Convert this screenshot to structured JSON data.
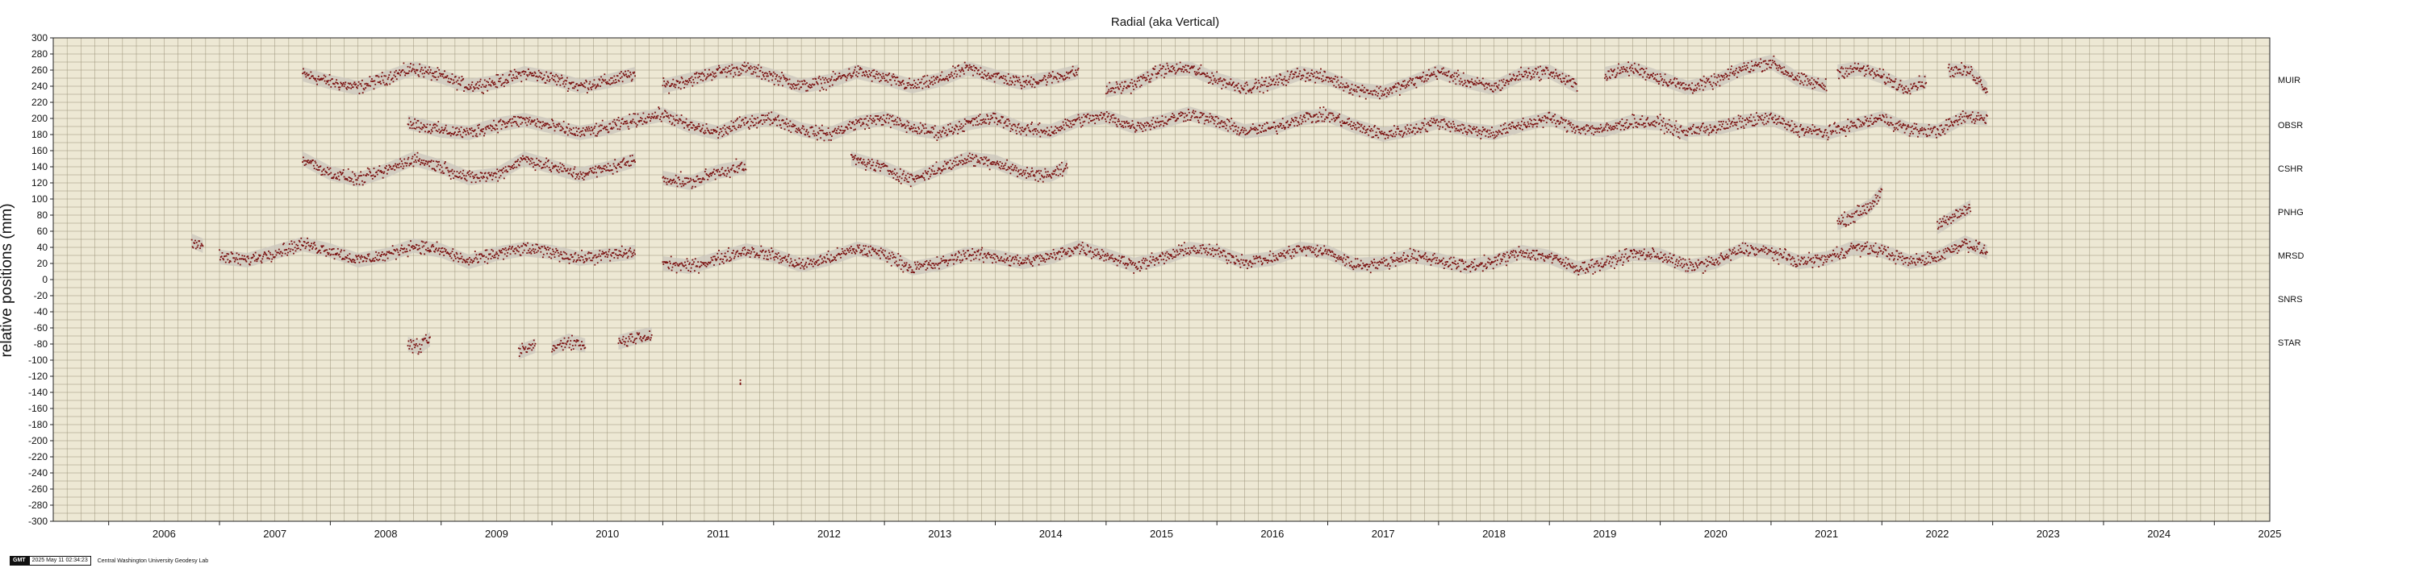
{
  "chart_data": {
    "type": "scatter",
    "title": "Radial (aka Vertical)",
    "ylabel": "relative positions (mm)",
    "xlabel": "",
    "xlim": [
      2005.5,
      2025.5
    ],
    "ylim": [
      -300,
      300
    ],
    "grid": true,
    "x_ticks": [
      "2006",
      "2007",
      "2008",
      "2009",
      "2010",
      "2011",
      "2012",
      "2013",
      "2014",
      "2015",
      "2016",
      "2017",
      "2018",
      "2019",
      "2020",
      "2021",
      "2022",
      "2023",
      "2024",
      "2025"
    ],
    "y_ticks": [
      300,
      280,
      260,
      240,
      220,
      200,
      180,
      160,
      140,
      120,
      100,
      80,
      60,
      40,
      20,
      0,
      -20,
      -40,
      -60,
      -80,
      -100,
      -120,
      -140,
      -160,
      -180,
      -200,
      -220,
      -240,
      -260,
      -280,
      -300
    ],
    "series": [
      {
        "name": "MUIR",
        "label_y": 248,
        "color": "#7a1010",
        "segments": [
          {
            "x": [
              2007.75,
              2008.0,
              2008.25,
              2008.5,
              2008.75,
              2009.0,
              2009.25,
              2009.5,
              2009.75,
              2010.0,
              2010.25,
              2010.5,
              2010.75
            ],
            "y": [
              255,
              245,
              238,
              250,
              262,
              252,
              240,
              245,
              256,
              250,
              240,
              246,
              255
            ]
          },
          {
            "x": [
              2011.0,
              2011.25,
              2011.5,
              2011.75,
              2012.0,
              2012.25,
              2012.5,
              2012.75,
              2013.0,
              2013.25,
              2013.5,
              2013.75,
              2014.0,
              2014.25,
              2014.5,
              2014.75
            ],
            "y": [
              240,
              248,
              258,
              262,
              252,
              240,
              246,
              258,
              250,
              240,
              248,
              262,
              252,
              244,
              250,
              258
            ]
          },
          {
            "x": [
              2015.0,
              2015.25,
              2015.5,
              2015.75,
              2016.0,
              2016.25,
              2016.5,
              2016.75,
              2017.0,
              2017.25,
              2017.5,
              2017.75,
              2018.0,
              2018.25,
              2018.5,
              2018.75,
              2019.0,
              2019.25
            ],
            "y": [
              235,
              242,
              260,
              262,
              248,
              238,
              244,
              256,
              250,
              236,
              232,
              244,
              258,
              246,
              238,
              255,
              258,
              240
            ]
          },
          {
            "x": [
              2019.5,
              2019.75,
              2020.0,
              2020.25,
              2020.5,
              2020.75,
              2021.0,
              2021.25,
              2021.5
            ],
            "y": [
              255,
              262,
              250,
              238,
              246,
              262,
              270,
              248,
              240
            ]
          },
          {
            "x": [
              2021.6,
              2021.8,
              2022.0,
              2022.2,
              2022.4
            ],
            "y": [
              258,
              262,
              252,
              238,
              246
            ]
          },
          {
            "x": [
              2022.6,
              2022.8,
              2022.95
            ],
            "y": [
              260,
              258,
              236
            ]
          }
        ]
      },
      {
        "name": "OBSR",
        "label_y": 192,
        "color": "#7a1010",
        "segments": [
          {
            "x": [
              2008.7,
              2009.0,
              2009.25,
              2009.5,
              2009.75,
              2010.0,
              2010.25,
              2010.5,
              2010.75,
              2011.0,
              2011.25,
              2011.5,
              2011.75,
              2012.0,
              2012.25,
              2012.5,
              2012.75,
              2013.0,
              2013.25,
              2013.5,
              2013.75,
              2014.0,
              2014.25,
              2014.5,
              2014.75,
              2015.0,
              2015.25,
              2015.5,
              2015.75,
              2016.0,
              2016.25,
              2016.5,
              2016.75,
              2017.0,
              2017.25,
              2017.5,
              2017.75,
              2018.0,
              2018.25,
              2018.5,
              2018.75,
              2019.0,
              2019.25,
              2019.5,
              2019.75,
              2020.0,
              2020.25
            ],
            "y": [
              195,
              185,
              182,
              192,
              198,
              190,
              182,
              188,
              198,
              205,
              190,
              182,
              196,
              200,
              186,
              180,
              194,
              200,
              188,
              182,
              194,
              200,
              186,
              184,
              198,
              202,
              190,
              196,
              206,
              196,
              184,
              188,
              200,
              204,
              190,
              180,
              186,
              196,
              186,
              182,
              192,
              200,
              188,
              186,
              196,
              194,
              180
            ]
          },
          {
            "x": [
              2020.25,
              2020.5,
              2020.75,
              2021.0,
              2021.25,
              2021.5,
              2021.75,
              2022.0,
              2022.25,
              2022.5,
              2022.75,
              2022.95
            ],
            "y": [
              186,
              188,
              196,
              200,
              186,
              182,
              192,
              200,
              186,
              184,
              202,
              200
            ]
          }
        ]
      },
      {
        "name": "CSHR",
        "label_y": 138,
        "color": "#7a1010",
        "segments": [
          {
            "x": [
              2007.75,
              2008.0,
              2008.25,
              2008.5,
              2008.75,
              2009.0,
              2009.25,
              2009.5,
              2009.75,
              2010.0,
              2010.25,
              2010.5,
              2010.75
            ],
            "y": [
              150,
              132,
              124,
              135,
              150,
              140,
              126,
              130,
              150,
              140,
              130,
              138,
              148
            ]
          },
          {
            "x": [
              2011.0,
              2011.25,
              2011.5,
              2011.75
            ],
            "y": [
              126,
              120,
              134,
              140
            ]
          },
          {
            "x": [
              2012.7,
              2013.0,
              2013.25,
              2013.5,
              2013.75,
              2014.0,
              2014.25,
              2014.5,
              2014.65
            ],
            "y": [
              150,
              138,
              124,
              138,
              150,
              146,
              132,
              130,
              140
            ]
          }
        ]
      },
      {
        "name": "PNHG",
        "label_y": 84,
        "color": "#7a1010",
        "segments": [
          {
            "x": [
              2021.6,
              2021.75,
              2021.9,
              2022.0
            ],
            "y": [
              70,
              80,
              92,
              110
            ]
          },
          {
            "x": [
              2022.5,
              2022.65,
              2022.8
            ],
            "y": [
              65,
              78,
              90
            ]
          }
        ]
      },
      {
        "name": "MRSD",
        "label_y": 30,
        "color": "#7a1010",
        "segments": [
          {
            "x": [
              2006.75,
              2006.85
            ],
            "y": [
              48,
              42
            ]
          },
          {
            "x": [
              2007.0,
              2007.25,
              2007.5,
              2007.75,
              2008.0,
              2008.25,
              2008.5,
              2008.75,
              2009.0,
              2009.25,
              2009.5,
              2009.75,
              2010.0,
              2010.25,
              2010.5,
              2010.75
            ],
            "y": [
              28,
              24,
              34,
              44,
              36,
              24,
              30,
              42,
              36,
              22,
              32,
              38,
              34,
              26,
              30,
              34
            ]
          },
          {
            "x": [
              2011.0,
              2011.25,
              2011.5,
              2011.75,
              2012.0,
              2012.25,
              2012.5,
              2012.75,
              2013.0,
              2013.25,
              2013.5,
              2013.75,
              2014.0,
              2014.25,
              2014.5,
              2014.75,
              2015.0,
              2015.25,
              2015.5,
              2015.75,
              2016.0,
              2016.25,
              2016.5,
              2016.75,
              2017.0,
              2017.25,
              2017.5,
              2017.75,
              2018.0,
              2018.25,
              2018.5,
              2018.75,
              2019.0,
              2019.25,
              2019.5,
              2019.75,
              2020.0,
              2020.25,
              2020.5,
              2020.75,
              2021.0,
              2021.25,
              2021.5,
              2021.75,
              2022.0,
              2022.25,
              2022.5,
              2022.75,
              2022.95
            ],
            "y": [
              20,
              16,
              26,
              36,
              30,
              18,
              26,
              38,
              32,
              14,
              20,
              32,
              28,
              22,
              28,
              40,
              30,
              18,
              26,
              38,
              34,
              22,
              26,
              38,
              34,
              18,
              20,
              30,
              24,
              16,
              22,
              34,
              28,
              14,
              20,
              32,
              30,
              16,
              22,
              38,
              34,
              22,
              26,
              40,
              36,
              22,
              28,
              46,
              34
            ]
          }
        ]
      },
      {
        "name": "SNRS",
        "label_y": -24,
        "color": "#7a1010",
        "segments": []
      },
      {
        "name": "STAR",
        "label_y": -78,
        "color": "#7a1010",
        "segments": [
          {
            "x": [
              2008.7,
              2008.8,
              2008.9
            ],
            "y": [
              -80,
              -84,
              -74
            ]
          },
          {
            "x": [
              2009.7,
              2009.85
            ],
            "y": [
              -90,
              -82
            ]
          },
          {
            "x": [
              2010.0,
              2010.15,
              2010.3
            ],
            "y": [
              -86,
              -76,
              -82
            ]
          },
          {
            "x": [
              2010.6,
              2010.75,
              2010.9
            ],
            "y": [
              -78,
              -72,
              -68
            ]
          },
          {
            "x": [
              2011.7
            ],
            "y": [
              -128
            ]
          }
        ]
      }
    ]
  },
  "footer": {
    "badge": "GMT",
    "timestamp": "2025 May 11 02:34:23",
    "lab": "Central Washington University Geodesy Lab"
  },
  "colors": {
    "plot_bg": "#ede8d4",
    "grid": "#9a9278",
    "data": "#7a1010",
    "band": "#c9c6bc"
  }
}
